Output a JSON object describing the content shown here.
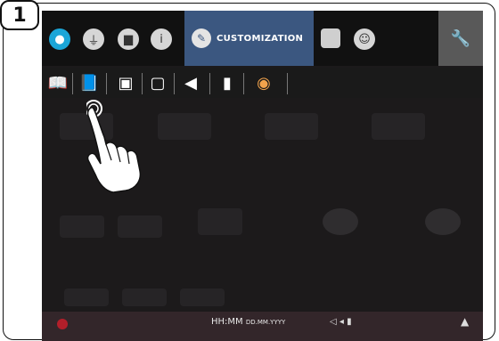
{
  "step": {
    "number": "1"
  },
  "top_nav": {
    "tabs": [
      {
        "icon": "water-drop-icon"
      },
      {
        "icon": "usb-icon"
      },
      {
        "icon": "book-icon"
      },
      {
        "icon": "info-icon"
      },
      {
        "icon": "pen-icon",
        "label": "CUSTOMIZATION",
        "active": true
      },
      {
        "icon": "monitor-icon"
      },
      {
        "icon": "user-icon"
      }
    ],
    "settings_icon": "wrench-icon",
    "active_color": "#3b5780"
  },
  "customization_toolbar": {
    "items": [
      {
        "icon": "book-icon"
      },
      {
        "icon": "book-blue-icon",
        "selected": true
      },
      {
        "icon": "image-icon"
      },
      {
        "icon": "tv-icon"
      },
      {
        "icon": "speaker-icon"
      },
      {
        "icon": "usb-stick-icon"
      },
      {
        "icon": "palette-icon"
      }
    ]
  },
  "status_bar": {
    "time": "HH:MM",
    "date": "DD.MM.YYYY",
    "controls": "◁ ◂ ▮"
  },
  "pointer": {
    "icon": "hand-pointer-icon"
  }
}
